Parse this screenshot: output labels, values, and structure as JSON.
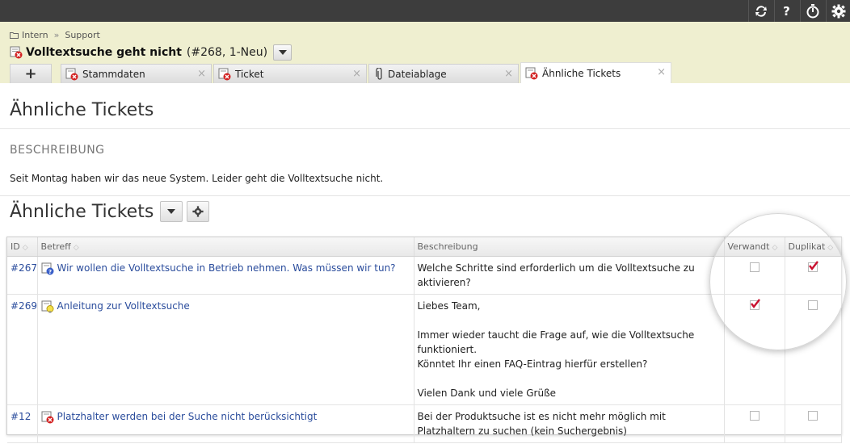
{
  "toolbar": {
    "icons": [
      "refresh-icon",
      "help-icon",
      "timer-icon",
      "gear-icon"
    ],
    "help_label": "?"
  },
  "breadcrumb": {
    "items": [
      "Intern",
      "Support"
    ],
    "separator": "»"
  },
  "ticket": {
    "title": "Volltextsuche geht nicht",
    "meta": "(#268, 1-Neu)"
  },
  "tabs": {
    "add_label": "+",
    "items": [
      {
        "label": "Stammdaten",
        "icon": "ticket-error-icon"
      },
      {
        "label": "Ticket",
        "icon": "ticket-error-icon"
      },
      {
        "label": "Dateiablage",
        "icon": "paperclip-icon"
      },
      {
        "label": "Ähnliche Tickets",
        "icon": "ticket-error-icon",
        "active": true
      }
    ],
    "close_label": "×"
  },
  "page": {
    "title": "Ähnliche Tickets",
    "description_label": "BESCHREIBUNG",
    "description_text": "Seit Montag haben wir das neue System. Leider geht die Volltextsuche nicht.",
    "section_title": "Ähnliche Tickets"
  },
  "table": {
    "columns": {
      "id": "ID",
      "subject": "Betreff",
      "description": "Beschreibung",
      "related": "Verwandt",
      "duplicate": "Duplikat"
    },
    "rows": [
      {
        "id": "#267",
        "icon": "ticket-question-icon",
        "subject": "Wir wollen die Volltextsuche in Betrieb nehmen. Was müssen wir tun?",
        "description": [
          "Welche Schritte sind erforderlich um die Volltextsuche zu aktivieren?"
        ],
        "related": false,
        "duplicate": true
      },
      {
        "id": "#269",
        "icon": "ticket-idea-icon",
        "subject": "Anleitung zur Volltextsuche",
        "description": [
          "Liebes Team,",
          "",
          "Immer wieder taucht die Frage auf, wie die Volltextsuche funktioniert.",
          "Könntet Ihr einen FAQ-Eintrag hierfür erstellen?",
          "",
          "Vielen Dank und viele Grüße"
        ],
        "related": true,
        "duplicate": false
      },
      {
        "id": "#12",
        "icon": "ticket-error-icon",
        "subject": "Platzhalter werden bei der Suche nicht berücksichtigt",
        "description": [
          "Bei der Produktsuche ist es nicht mehr möglich mit Platzhaltern zu suchen (kein Suchergebnis)"
        ],
        "related": false,
        "duplicate": false
      }
    ]
  },
  "colors": {
    "topbar": "#3d3d3d",
    "header_bg": "#efefd0",
    "link": "#2a4c9c",
    "check": "#c8102e"
  }
}
